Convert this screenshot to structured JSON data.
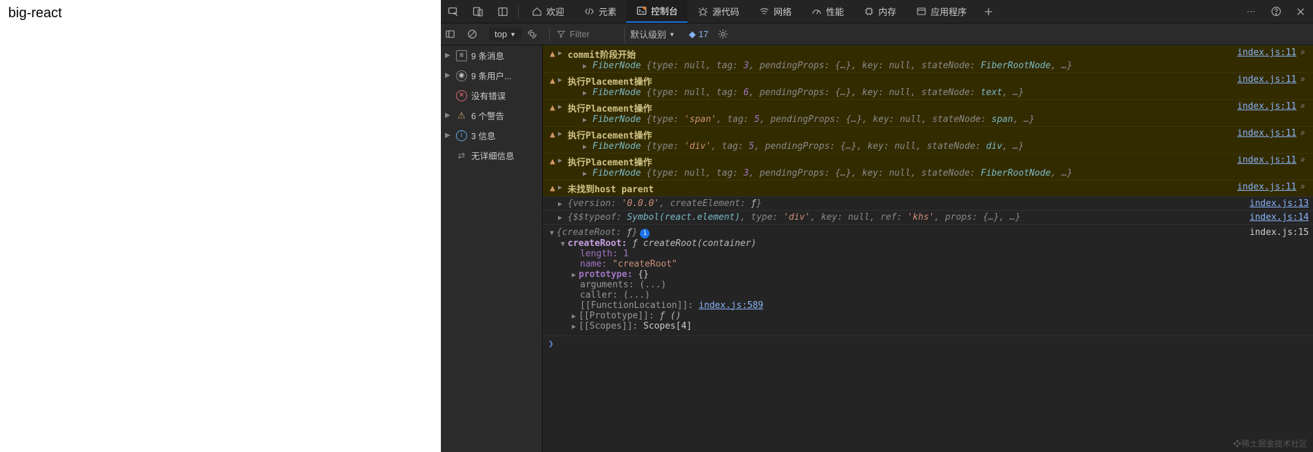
{
  "page": {
    "title": "big-react"
  },
  "tabs": {
    "welcome": "欢迎",
    "elements": "元素",
    "console": "控制台",
    "sources": "源代码",
    "network": "网络",
    "performance": "性能",
    "memory": "内存",
    "application": "应用程序"
  },
  "subbar": {
    "context": "top",
    "filter_placeholder": "Filter",
    "level": "默认级别",
    "issues_count": "17"
  },
  "sidebar": {
    "messages": "9 条消息",
    "user": "9 条用户...",
    "errors": "没有错误",
    "warnings": "6 个警告",
    "info": "3 信息",
    "verbose": "无详细信息"
  },
  "src": {
    "l11": "index.js:11",
    "l13": "index.js:13",
    "l14": "index.js:14",
    "l15": "index.js:15",
    "l589": "index.js:589"
  },
  "logs": {
    "w1_title": "commit阶段开始",
    "w1_fiber": "FiberNode {type: null, tag: 3, pendingProps: {…}, key: null, stateNode: FiberRootNode, …}",
    "w2_title": "执行Placement操作",
    "w2_fiber": "FiberNode {type: null, tag: 6, pendingProps: {…}, key: null, stateNode: text, …}",
    "w3_title": "执行Placement操作",
    "w3_fiber": "FiberNode {type: 'span', tag: 5, pendingProps: {…}, key: null, stateNode: span, …}",
    "w4_title": "执行Placement操作",
    "w4_fiber": "FiberNode {type: 'div', tag: 5, pendingProps: {…}, key: null, stateNode: div, …}",
    "w5_title": "执行Placement操作",
    "w5_fiber": "FiberNode {type: null, tag: 3, pendingProps: {…}, key: null, stateNode: FiberRootNode, …}",
    "w6_title": "未找到host parent",
    "p1": "{version: '0.0.0', createElement: ƒ}",
    "p2": "{$$typeof: Symbol(react.element), type: 'div', key: null, ref: 'khs', props: {…}, …}",
    "p3_head": "{createRoot: ƒ}",
    "cr_label": "createRoot:",
    "cr_val": "ƒ createRoot(container)",
    "len_k": "length:",
    "len_v": "1",
    "name_k": "name:",
    "name_v": "\"createRoot\"",
    "proto_k": "prototype:",
    "proto_v": "{}",
    "args_k": "arguments:",
    "args_v": "(...)",
    "caller_k": "caller:",
    "caller_v": "(...)",
    "floc_k": "[[FunctionLocation]]:",
    "proto2_k": "[[Prototype]]:",
    "proto2_v": "ƒ ()",
    "scopes_k": "[[Scopes]]:",
    "scopes_v": "Scopes[4]"
  },
  "watermark": "❖稀土掘金技术社区"
}
